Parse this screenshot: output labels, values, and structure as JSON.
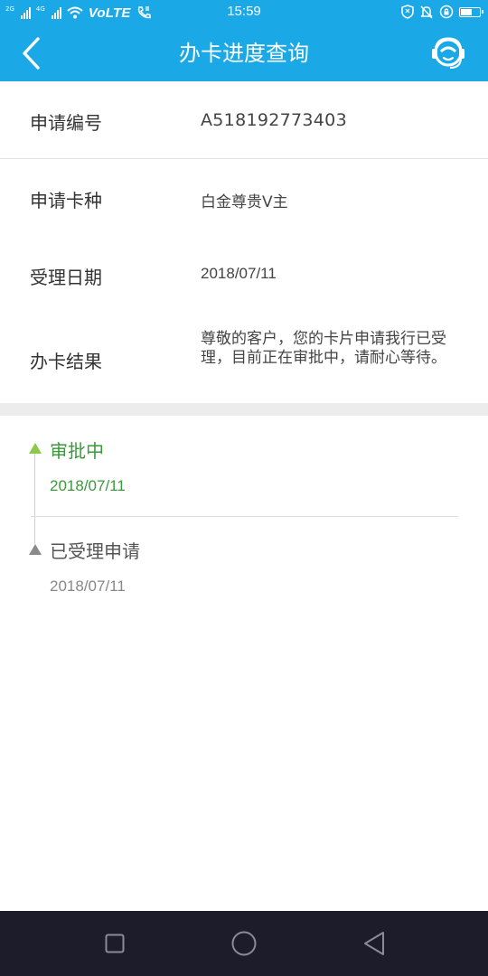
{
  "status_bar": {
    "network_1": "2G",
    "network_2": "4G",
    "volte": "VoLTE",
    "time": "15:59",
    "battery_level": 0.55
  },
  "header": {
    "title": "办卡进度查询",
    "back_icon": "chevron-left-icon",
    "service_icon": "customer-service-icon"
  },
  "details": {
    "application_number": {
      "label": "申请编号",
      "value": "A518192773403"
    },
    "card_type": {
      "label": "申请卡种",
      "value": "白金尊贵V主"
    },
    "accept_date": {
      "label": "受理日期",
      "value": "2018/07/11"
    },
    "result": {
      "label": "办卡结果",
      "value": "尊敬的客户，您的卡片申请我行已受理，目前正在审批中，请耐心等待。"
    }
  },
  "timeline": [
    {
      "title": "审批中",
      "date": "2018/07/11",
      "state": "current",
      "color": "#3a9a3a"
    },
    {
      "title": "已受理申请",
      "date": "2018/07/11",
      "state": "done",
      "color": "#555555"
    }
  ],
  "colors": {
    "accent": "#1aa9e6",
    "current_step": "#8cc84b",
    "navbar": "#1d1c2a"
  },
  "nav_bar": {
    "recent_icon": "square-icon",
    "home_icon": "circle-icon",
    "back_icon": "triangle-back-icon"
  }
}
